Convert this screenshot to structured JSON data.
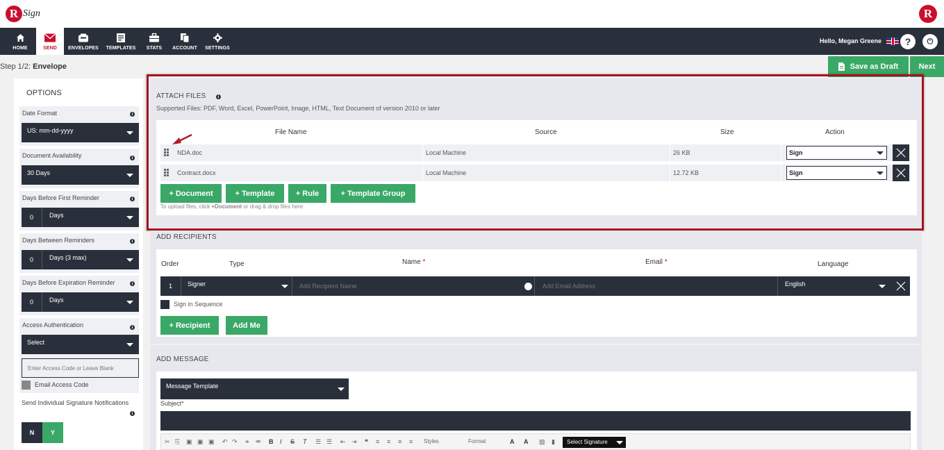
{
  "app": {
    "logo_initial": "R",
    "logo_text": "Sign"
  },
  "nav": [
    {
      "label": "HOME",
      "icon": "home-icon"
    },
    {
      "label": "SEND",
      "icon": "envelope-icon"
    },
    {
      "label": "ENVELOPES",
      "icon": "inbox-icon"
    },
    {
      "label": "TEMPLATES",
      "icon": "template-icon"
    },
    {
      "label": "STATS",
      "icon": "briefcase-icon"
    },
    {
      "label": "ACCOUNT",
      "icon": "account-icon"
    },
    {
      "label": "SETTINGS",
      "icon": "gear-icon"
    }
  ],
  "user": {
    "greeting": "Hello, Megan Greene",
    "help_symbol": "?",
    "power_symbol": "⏻"
  },
  "step": {
    "prefix": "Step 1/2:",
    "name": "Envelope"
  },
  "actions": {
    "save_draft": "Save as Draft",
    "next": "Next"
  },
  "sidebar": {
    "title": "OPTIONS",
    "date_format": {
      "label": "Date Format",
      "value": "US: mm-dd-yyyy"
    },
    "availability": {
      "label": "Document Availability",
      "value": "30 Days"
    },
    "first_reminder": {
      "label": "Days Before First Reminder",
      "num": "0",
      "value": "Days"
    },
    "between_reminders": {
      "label": "Days Between Reminders",
      "num": "0",
      "value": "Days (3 max)"
    },
    "expiration_reminder": {
      "label": "Days Before Expiration Reminder",
      "num": "0",
      "value": "Days"
    },
    "access_auth": {
      "label": "Access Authentication",
      "value": "Select",
      "placeholder": "Enter Access Code or Leave Blank",
      "email_code": "Email Access Code"
    },
    "individual_notifications": {
      "label": "Send Individual Signature Notifications",
      "no": "N",
      "yes": "Y"
    }
  },
  "attach": {
    "title": "ATTACH FILES",
    "supported": "Supported Files: PDF, Word, Excel, PowerPoint, Image, HTML, Text Document of version 2010 or later",
    "headers": {
      "file_name": "File Name",
      "source": "Source",
      "size": "Size",
      "action": "Action"
    },
    "files": [
      {
        "name": "NDA.doc",
        "source": "Local Machine",
        "size": "26 KB",
        "action": "Sign"
      },
      {
        "name": "Contract.docx",
        "source": "Local Machine",
        "size": "12.72 KB",
        "action": "Sign"
      }
    ],
    "buttons": {
      "document": "+ Document",
      "template": "+ Template",
      "rule": "+ Rule",
      "template_group": "+ Template Group"
    },
    "hint_pre": "To upload files, click ",
    "hint_bold": "+Document",
    "hint_post": " or drag & drop files here"
  },
  "recipients": {
    "title": "ADD RECIPIENTS",
    "headers": {
      "order": "Order",
      "type": "Type",
      "name": "Name",
      "email": "Email",
      "language": "Language",
      "required": "*"
    },
    "row": {
      "order": "1",
      "type": "Signer",
      "name_placeholder": "Add Recipient Name",
      "email_placeholder": "Add Email Address",
      "language": "English"
    },
    "sign_in_sequence": "Sign in Sequence",
    "buttons": {
      "recipient": "+ Recipient",
      "add_me": "Add Me"
    }
  },
  "message": {
    "title": "ADD MESSAGE",
    "template_select": "Message Template",
    "subject_label": "Subject*",
    "toolbar": {
      "styles": "Styles",
      "format": "Format",
      "signature": "Select Signature"
    }
  }
}
